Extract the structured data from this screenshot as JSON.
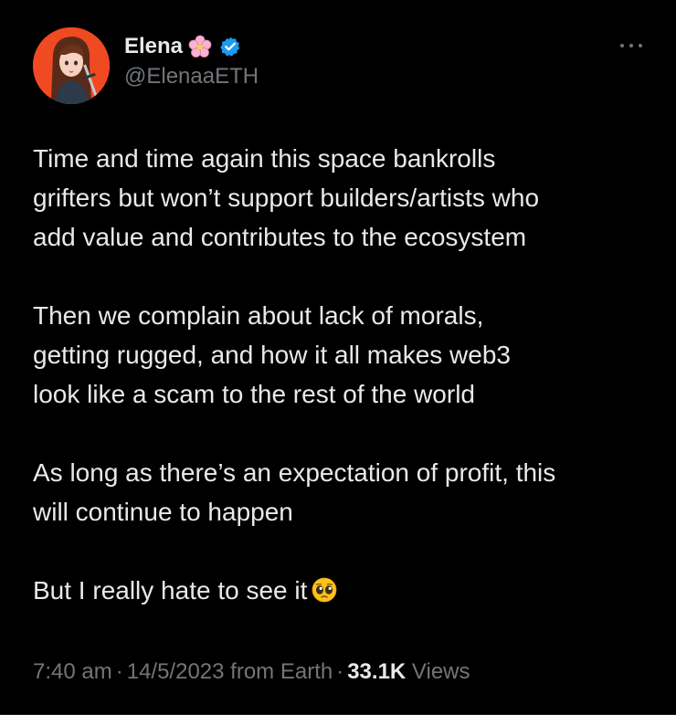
{
  "author": {
    "display_name": "Elena",
    "handle": "@ElenaaETH",
    "verified": true
  },
  "tweet": {
    "paragraphs": [
      "Time and time again this space bankrolls\ngrifters but won’t support builders/artists who\nadd value and contributes to the ecosystem",
      "Then we complain about lack of morals,\ngetting rugged, and how it all makes web3\nlook like a scam to the rest of the world",
      "As long as there’s an expectation of profit, this\nwill continue to happen",
      "But I really hate to see it"
    ]
  },
  "meta": {
    "time": "7:40 am",
    "date": "14/5/2023",
    "source": "from Earth",
    "separator": "·",
    "views_count": "33.1K",
    "views_label": "Views"
  },
  "icons": {
    "flower": "cherry-blossom-emoji",
    "verified": "verified-badge",
    "more": "more-options",
    "emoji": "pleading-face-emoji"
  },
  "colors": {
    "background": "#000000",
    "text": "#e7e9ea",
    "secondary": "#71767b",
    "verified": "#1d9bf0",
    "avatar_bg": "#f04a22"
  }
}
